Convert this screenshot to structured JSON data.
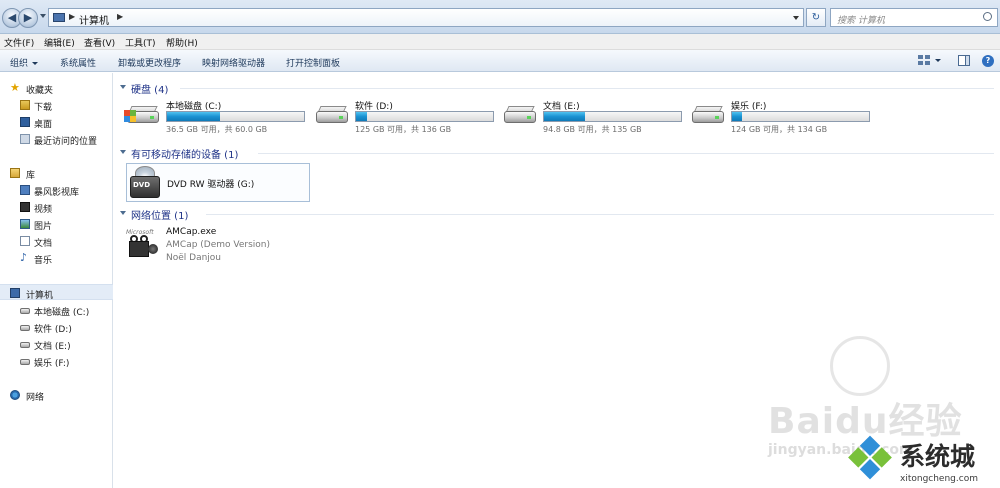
{
  "address": {
    "crumb": "计算机",
    "search_placeholder": "搜索 计算机"
  },
  "menu": [
    "文件(F)",
    "编辑(E)",
    "查看(V)",
    "工具(T)",
    "帮助(H)"
  ],
  "commands": {
    "organize": "组织",
    "system_properties": "系统属性",
    "uninstall": "卸载或更改程序",
    "map_drive": "映射网络驱动器",
    "control_panel": "打开控制面板"
  },
  "sidebar": {
    "favorites": "收藏夹",
    "downloads": "下载",
    "desktop": "桌面",
    "recent": "最近访问的位置",
    "libraries": "库",
    "baofeng": "暴风影视库",
    "videos": "视频",
    "pictures": "图片",
    "documents": "文档",
    "music": "音乐",
    "computer": "计算机",
    "drive_c": "本地磁盘 (C:)",
    "drive_d": "软件 (D:)",
    "drive_e": "文档 (E:)",
    "drive_f": "娱乐 (F:)",
    "network": "网络"
  },
  "groups": {
    "hard_disks": "硬盘 (4)",
    "removable": "有可移动存储的设备 (1)",
    "network_locations": "网络位置 (1)"
  },
  "drives": [
    {
      "name": "本地磁盘 (C:)",
      "info": "36.5 GB 可用，共 60.0 GB",
      "used_fraction": 0.39
    },
    {
      "name": "软件 (D:)",
      "info": "125 GB 可用，共 136 GB",
      "used_fraction": 0.08
    },
    {
      "name": "文档 (E:)",
      "info": "94.8 GB 可用，共 135 GB",
      "used_fraction": 0.3
    },
    {
      "name": "娱乐 (F:)",
      "info": "124 GB 可用，共 134 GB",
      "used_fraction": 0.07
    }
  ],
  "dvd": {
    "label": "DVD RW 驱动器 (G:)",
    "badge": "DVD"
  },
  "app": {
    "name": "AMCap.exe",
    "description": "AMCap (Demo Version)",
    "author": "Noël Danjou",
    "logo_text": "Microsoft"
  },
  "watermarks": {
    "baidu": "Baidu经验",
    "jingyan": "jingyan.baidu.com",
    "site_cn": "系统城",
    "site_url": "xitongcheng.com"
  },
  "colors": {
    "group_title": "#1e3287",
    "usage_bar": "#1a92d2",
    "selection": "#e3ecf7"
  }
}
